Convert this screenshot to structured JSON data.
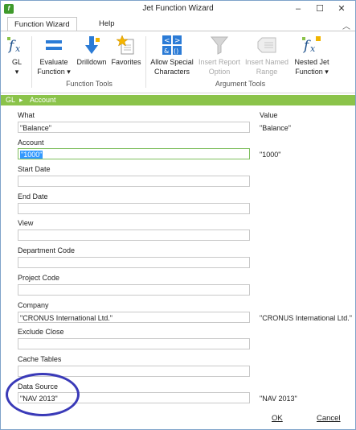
{
  "window": {
    "title": "Jet Function Wizard",
    "app_icon_label": "f"
  },
  "tabs": [
    {
      "label": "Function Wizard"
    },
    {
      "label": "Help"
    }
  ],
  "ribbon": {
    "gl": {
      "label": "GL",
      "sub": "▾"
    },
    "evaluate": {
      "label": "Evaluate",
      "sub": "Function ▾"
    },
    "drilldown": {
      "label": "Drilldown"
    },
    "favorites": {
      "label": "Favorites"
    },
    "group_function_tools": "Function Tools",
    "allow_special": {
      "label": "Allow Special",
      "sub": "Characters"
    },
    "insert_report": {
      "label": "Insert Report",
      "sub": "Option"
    },
    "insert_named": {
      "label": "Insert Named",
      "sub": "Range"
    },
    "nested_jet": {
      "label": "Nested Jet",
      "sub": "Function ▾"
    },
    "group_argument_tools": "Argument Tools"
  },
  "breadcrumb": {
    "root": "GL",
    "separator": "▸",
    "current": "Account"
  },
  "headers": {
    "what": "What",
    "value": "Value"
  },
  "fields": [
    {
      "label": "",
      "input": "\"Balance\"",
      "value": "\"Balance\""
    },
    {
      "label": "Account",
      "input": "\"1000\"",
      "value": "\"1000\""
    },
    {
      "label": "Start Date",
      "input": "",
      "value": ""
    },
    {
      "label": "End Date",
      "input": "",
      "value": ""
    },
    {
      "label": "View",
      "input": "",
      "value": ""
    },
    {
      "label": "Department Code",
      "input": "",
      "value": ""
    },
    {
      "label": "Project Code",
      "input": "",
      "value": ""
    },
    {
      "label": "Company",
      "input": "\"CRONUS International Ltd.\"",
      "value": "\"CRONUS International Ltd.\""
    },
    {
      "label": "Exclude Close",
      "input": "",
      "value": ""
    },
    {
      "label": "Cache Tables",
      "input": "",
      "value": ""
    },
    {
      "label": "Data Source",
      "input": "\"NAV 2013\"",
      "value": "\"NAV 2013\""
    }
  ],
  "buttons": {
    "ok": "OK",
    "cancel": "Cancel"
  },
  "colors": {
    "accent_green": "#8bc34a",
    "annotation_circle": "#3a3ab8",
    "selection": "#3399ff"
  }
}
